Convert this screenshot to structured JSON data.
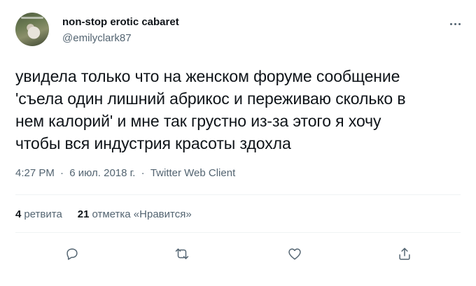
{
  "author": {
    "display_name": "non-stop erotic cabaret",
    "handle": "@emilyclark87",
    "avatar_icon": "avatar-photo"
  },
  "tweet": {
    "lines": [
      "увидела только что на женском форуме сообщение",
      "'съела один лишний абрикос и переживаю сколько в",
      "нем калорий' и мне так грустно из-за этого я хочу",
      "чтобы вся индустрия красоты здохла"
    ],
    "time": "4:27 PM",
    "date": "6 июл. 2018 г.",
    "source": "Twitter Web Client",
    "separator": "·"
  },
  "stats": {
    "retweets_count": "4",
    "retweets_label": "ретвита",
    "likes_count": "21",
    "likes_label": "отметка «Нравится»"
  },
  "actions": [
    "reply-icon",
    "retweet-icon",
    "like-icon",
    "share-icon"
  ],
  "colors": {
    "text": "#0f1419",
    "secondary": "#536471",
    "divider": "#eff3f4"
  }
}
